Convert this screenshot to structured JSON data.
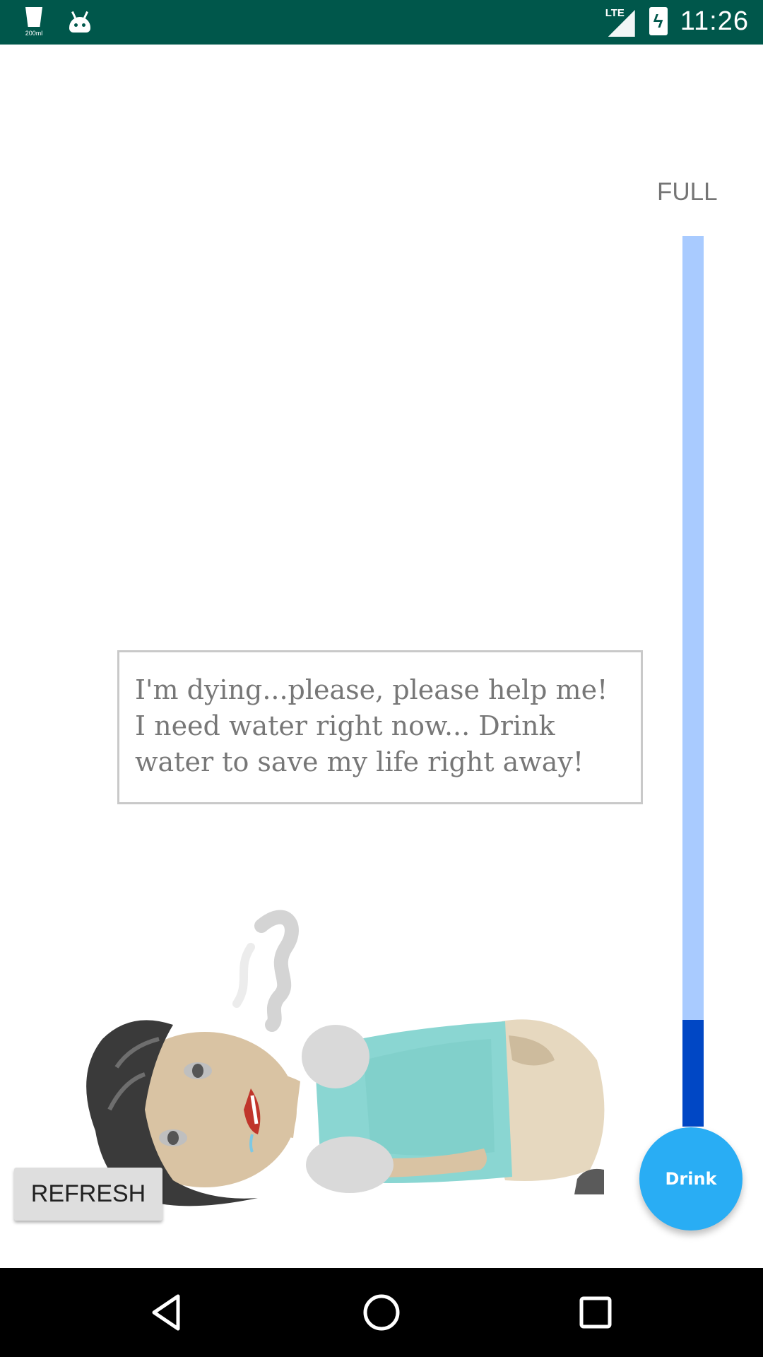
{
  "status_bar": {
    "app_icon_label": "200ml",
    "network": "LTE",
    "time": "11:26"
  },
  "meter": {
    "top_label": "FULL",
    "level_fraction": 0.12
  },
  "speech_bubble": {
    "text": "I'm dying...please, please help me! I need water right now... Drink water to save my life right away!"
  },
  "buttons": {
    "refresh_label": "REFRESH",
    "drink_label": "Drink"
  },
  "colors": {
    "status_bar": "#00574b",
    "meter_empty": "#a9cbff",
    "meter_fill": "#0047c5",
    "fab": "#29adf4"
  },
  "nav_bar": {
    "icons": [
      "back-icon",
      "home-icon",
      "recents-icon"
    ]
  }
}
